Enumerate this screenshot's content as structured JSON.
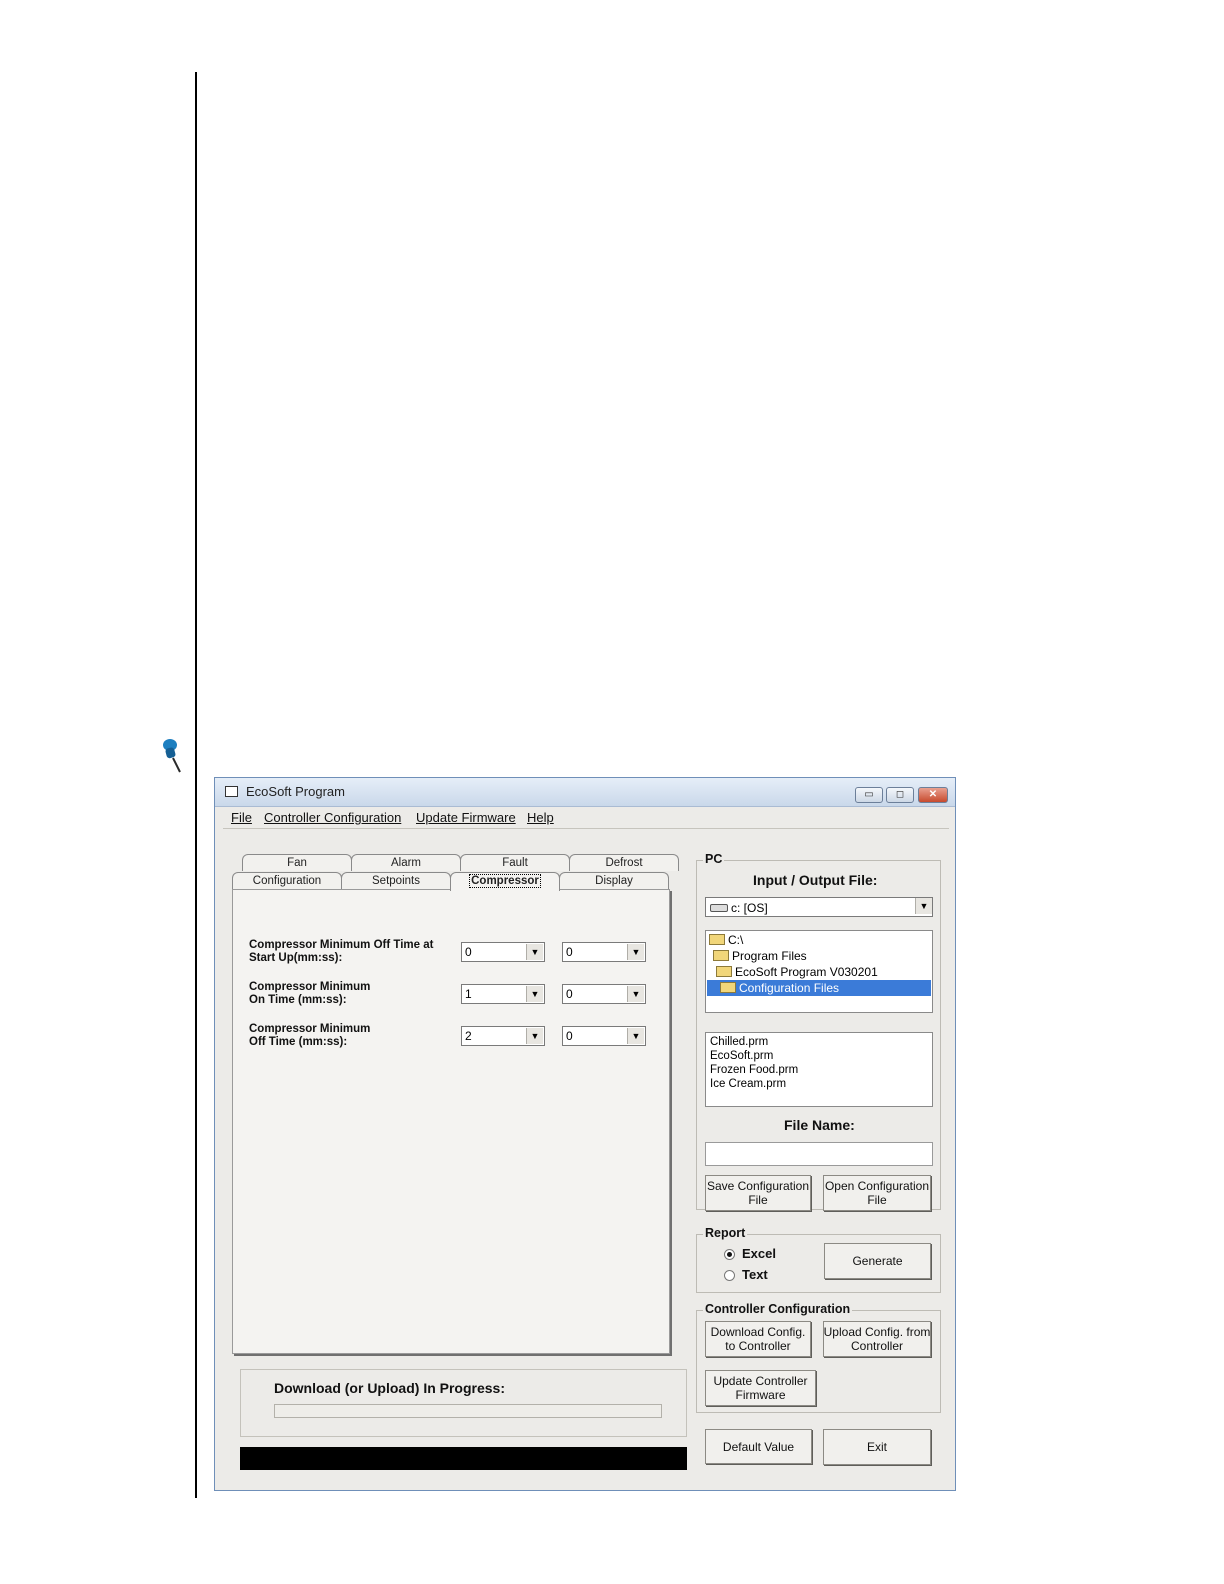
{
  "window": {
    "title": "EcoSoft Program",
    "min": "▭",
    "max": "◻",
    "close": "✕"
  },
  "menu": [
    "File",
    "Controller Configuration",
    "Update Firmware",
    "Help"
  ],
  "tabs": {
    "back_row": [
      "Fan",
      "Alarm",
      "Fault",
      "Defrost"
    ],
    "front_row": [
      "Configuration",
      "Setpoints",
      "Compressor",
      "Display"
    ],
    "active": "Compressor"
  },
  "compressor": {
    "fields": [
      {
        "label": "Compressor Minimum Off Time at\nStart Up(mm:ss):",
        "minutes": "0",
        "seconds": "0"
      },
      {
        "label": "Compressor Minimum\nOn Time (mm:ss):",
        "minutes": "1",
        "seconds": "0"
      },
      {
        "label": "Compressor Minimum\nOff Time (mm:ss):",
        "minutes": "2",
        "seconds": "0"
      }
    ]
  },
  "progress": {
    "label": "Download (or Upload) In Progress:",
    "value": 0
  },
  "pc": {
    "title": "PC",
    "io_heading": "Input / Output File:",
    "drive": "c: [OS]",
    "dirs": [
      "C:\\",
      "Program Files",
      "EcoSoft Program V030201",
      "Configuration Files"
    ],
    "selected_dir": "Configuration Files",
    "files": [
      "Chilled.prm",
      "EcoSoft.prm",
      "Frozen Food.prm",
      "Ice Cream.prm"
    ],
    "file_name_heading": "File Name:",
    "file_name_value": "",
    "save_button": "Save Configuration\nFile",
    "open_button": "Open Configuration\nFile"
  },
  "report": {
    "title": "Report",
    "options": [
      "Excel",
      "Text"
    ],
    "selected": "Excel",
    "generate_button": "Generate"
  },
  "controller_config": {
    "title": "Controller Configuration",
    "download_button": "Download Config.\nto Controller",
    "upload_button": "Upload Config. from\nController",
    "update_button": "Update Controller\nFirmware"
  },
  "footer": {
    "default_button": "Default Value",
    "exit_button": "Exit"
  },
  "icons": {
    "dropdown": "▼",
    "radio": "radio-icon",
    "folder": "folder-icon",
    "drive": "drive-icon",
    "pin": "pushpin-icon"
  },
  "colors": {
    "selection": "#3b7bd8",
    "titlebar": "#c9d8ea",
    "pin": "#1d7fc0"
  }
}
